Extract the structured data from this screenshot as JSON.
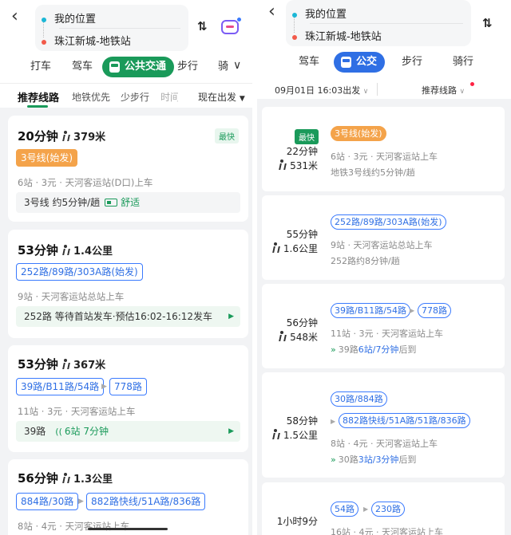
{
  "left": {
    "origin": "我的位置",
    "destination": "珠江新城-地铁站",
    "modes": [
      "打车",
      "驾车",
      "公共交通",
      "步行",
      "骑"
    ],
    "tabs": [
      "推荐线路",
      "地铁优先",
      "少步行",
      "时间"
    ],
    "depart": "现在出发",
    "routes": [
      {
        "time": "20分钟",
        "walk": "379米",
        "tag": "最快",
        "lines": [
          "3号线(始发)"
        ],
        "info": "6站 · 3元 · 天河客运站(D口)上车",
        "bar_prefix": "3号线  约5分钟/趟",
        "bar_suffix": "舒适"
      },
      {
        "time": "53分钟",
        "walk": "1.4公里",
        "lines": [
          "252路/89路/303A路(始发)"
        ],
        "info": "9站 · 天河客运站总站上车",
        "bar_prefix": "252路  等待首站发车·预估16:02-16:12发车"
      },
      {
        "time": "53分钟",
        "walk": "367米",
        "lines": [
          "39路/B11路/54路",
          "778路"
        ],
        "info": "11站 · 3元 · 天河客运站上车",
        "bar_prefix": "39路",
        "bar_highlight": "6站 7分钟"
      },
      {
        "time": "56分钟",
        "walk": "1.3公里",
        "lines": [
          "884路/30路",
          "882路快线/51A路/836路"
        ],
        "info": "8站 · 4元 · 天河客运站上车"
      }
    ]
  },
  "right": {
    "origin": "我的位置",
    "destination": "珠江新城-地铁站",
    "modes": [
      "驾车",
      "公交",
      "步行",
      "骑行"
    ],
    "depart": "09月01日 16:03出发",
    "sort": "推荐线路",
    "routes": [
      {
        "tag": "最快",
        "time": "22分钟",
        "walk": "531米",
        "lines": [
          "3号线(始发)"
        ],
        "info": "6站 · 3元 · 天河客运站上车",
        "info2": "地铁3号线约5分钟/趟"
      },
      {
        "time": "55分钟",
        "walk": "1.6公里",
        "lines": [
          "252路/89路/303A路(始发)"
        ],
        "info": "9站 · 天河客运站总站上车",
        "info2": "252路约8分钟/趟"
      },
      {
        "time": "56分钟",
        "walk": "548米",
        "lines": [
          "39路/B11路/54路",
          "778路"
        ],
        "info": "11站 · 3元 · 天河客运站上车",
        "info2_prefix": "39路",
        "info2_hl": "6站/7分钟",
        "info2_suffix": "后到"
      },
      {
        "time": "58分钟",
        "walk": "1.5公里",
        "lines": [
          "30路/884路",
          "882路快线/51A路/51路/836路"
        ],
        "info": "8站 · 4元 · 天河客运站上车",
        "info2_prefix": "30路",
        "info2_hl": "3站/3分钟",
        "info2_suffix": "后到"
      },
      {
        "time": "1小时9分",
        "lines": [
          "54路",
          "230路"
        ],
        "info": "16站 · 4元 · 天河客运站上车"
      }
    ]
  }
}
